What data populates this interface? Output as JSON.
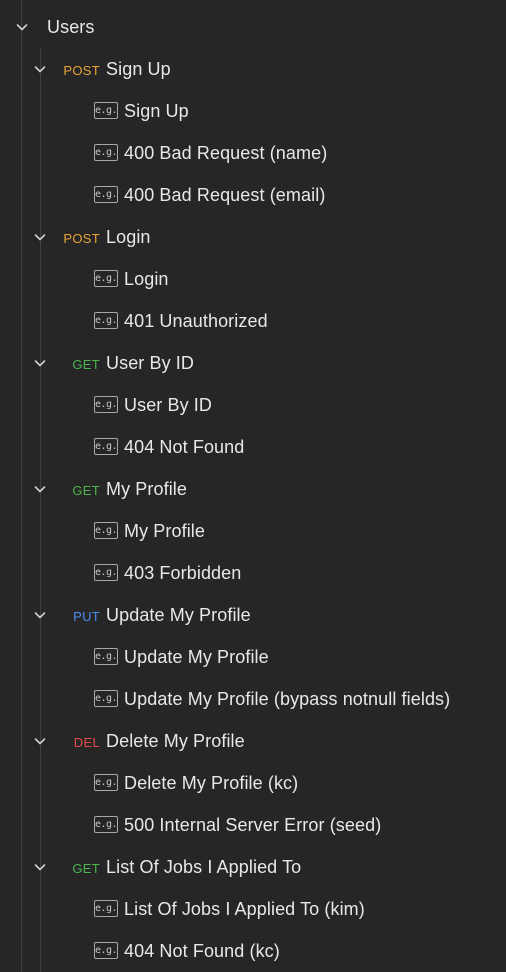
{
  "folder": {
    "label": "Users"
  },
  "colors": {
    "POST": "#e8a33a",
    "GET": "#4fb34f",
    "PUT": "#4b8ef0",
    "DEL": "#e34b4b"
  },
  "example_icon_text": "e.g.",
  "requests": [
    {
      "method": "POST",
      "name": "Sign Up",
      "examples": [
        "Sign Up",
        "400 Bad Request (name)",
        "400 Bad Request (email)"
      ]
    },
    {
      "method": "POST",
      "name": "Login",
      "examples": [
        "Login",
        "401 Unauthorized"
      ]
    },
    {
      "method": "GET",
      "name": "User By ID",
      "examples": [
        "User By ID",
        "404 Not Found"
      ]
    },
    {
      "method": "GET",
      "name": "My Profile",
      "examples": [
        "My Profile",
        "403 Forbidden"
      ]
    },
    {
      "method": "PUT",
      "name": "Update My Profile",
      "examples": [
        "Update My Profile",
        "Update My Profile (bypass notnull fields)"
      ]
    },
    {
      "method": "DEL",
      "name": "Delete My Profile",
      "examples": [
        "Delete My Profile (kc)",
        "500 Internal Server Error (seed)"
      ]
    },
    {
      "method": "GET",
      "name": "List Of Jobs I Applied To",
      "examples": [
        "List Of Jobs I Applied To (kim)",
        "404 Not Found (kc)"
      ]
    }
  ]
}
